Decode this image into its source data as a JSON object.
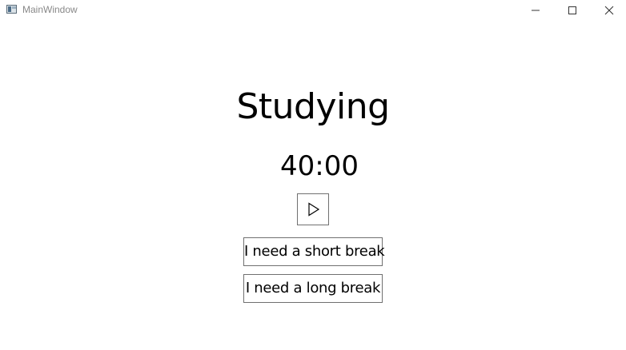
{
  "window": {
    "title": "MainWindow"
  },
  "main": {
    "mode_label": "Studying",
    "timer": "40:00",
    "play_icon": "play-icon",
    "short_break_label": "I need a short break",
    "long_break_label": "I need a long break"
  },
  "colors": {
    "background": "#ffffff",
    "text": "#000000",
    "border": "#707070",
    "title_text": "#888888"
  }
}
